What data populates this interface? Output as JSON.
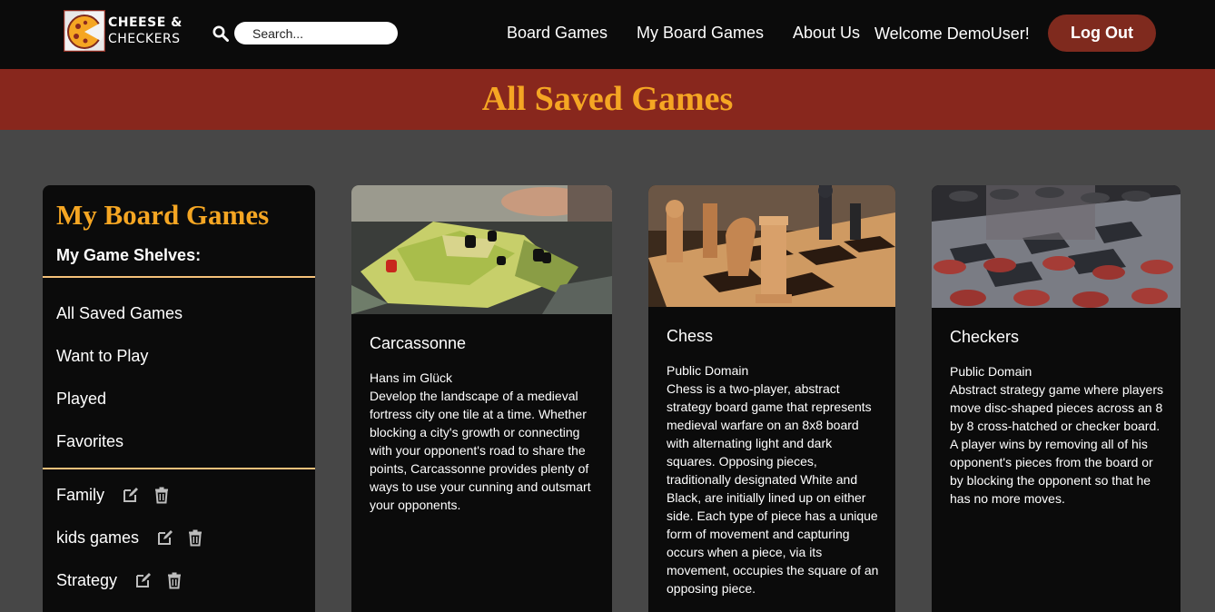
{
  "app": {
    "logo_line1": "CHEESE &",
    "logo_line2": "CHECKERS",
    "brand_color": "#88271d",
    "accent_color": "#f5a623"
  },
  "header": {
    "search_placeholder": "Search...",
    "nav": [
      "Board Games",
      "My Board Games",
      "About Us"
    ],
    "welcome": "Welcome DemoUser!",
    "logout_label": "Log Out"
  },
  "banner": {
    "title": "All Saved Games"
  },
  "sidebar": {
    "title": "My Board Games",
    "shelves_heading": "My Game Shelves:",
    "default_shelves": [
      "All Saved Games",
      "Want to Play",
      "Played",
      "Favorites"
    ],
    "custom_shelves": [
      {
        "label": "Family",
        "icons": [
          "edit-icon",
          "trash-icon"
        ]
      },
      {
        "label": "kids games",
        "icons": [
          "edit-icon",
          "trash-icon"
        ]
      },
      {
        "label": "Strategy",
        "icons": [
          "edit-icon",
          "trash-icon"
        ]
      }
    ]
  },
  "games": [
    {
      "title": "Carcassonne",
      "publisher": "Hans im Glück",
      "description": "Develop the landscape of a medieval fortress city one tile at a time. Whether blocking a city's growth or connecting with your opponent's road to share the points, Carcassonne provides plenty of ways to use your cunning and outsmart your opponents."
    },
    {
      "title": "Chess",
      "publisher": "Public Domain",
      "description": "Chess is a two-player, abstract strategy board game that represents medieval warfare on an 8x8 board with alternating light and dark squares. Opposing pieces, traditionally designated White and Black, are initially lined up on either side. Each type of piece has a unique form of movement and capturing occurs when a piece, via its movement, occupies the square of an opposing piece."
    },
    {
      "title": "Checkers",
      "publisher": "Public Domain",
      "description": "Abstract strategy game where players move disc-shaped pieces across an 8 by 8 cross-hatched or checker board. A player wins by removing all of his opponent's pieces from the board or by blocking the opponent so that he has no more moves."
    }
  ]
}
